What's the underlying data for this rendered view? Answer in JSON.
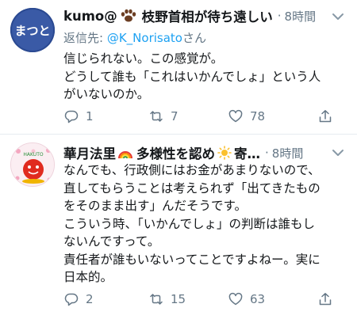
{
  "tweets": [
    {
      "display_name": "kumo@",
      "name_tail": "枝野首相が待ち遠しい",
      "time": "8時間",
      "reply_prefix": "返信先: ",
      "reply_handle": "@K_Norisato",
      "reply_suffix": "さん",
      "avatar_text": "まつと",
      "lines": [
        "信じられない。この感覚が。",
        "どうして誰も「これはいかんでしょ」という人",
        "がいないのか。"
      ],
      "replies": "1",
      "retweets": "7",
      "likes": "78"
    },
    {
      "display_name": "華月法里",
      "name_tail": "多様性を認め",
      "name_tail2": "寄…",
      "time": "8時間",
      "avatar_text": "HAKUTO",
      "lines": [
        "なんでも、行政側にはお金があまりないので、",
        "直してもらうことは考えられず「出てきたもの",
        "をそのまま出す」んだそうです。",
        "こういう時、「いかんでしょ」の判断は誰もし",
        "ないんですって。",
        "責任者が誰もいないってことですよねー。実に",
        "日本的。"
      ],
      "replies": "2",
      "retweets": "15",
      "likes": "63"
    }
  ],
  "colors": {
    "text": "#14171a",
    "secondary": "#657786",
    "link": "#1da1f2",
    "divider": "#e6ecf0"
  },
  "icons": [
    "reply-icon",
    "retweet-icon",
    "like-icon",
    "share-icon",
    "chevron-down-icon",
    "paw-icon",
    "rainbow-icon",
    "sun-icon"
  ]
}
